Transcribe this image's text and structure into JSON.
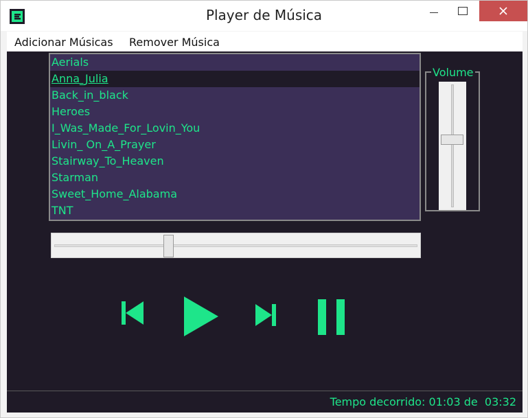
{
  "window": {
    "title": "Player de Música"
  },
  "menu": {
    "items": [
      "Adicionar Músicas",
      "Remover Música"
    ]
  },
  "playlist": {
    "songs": [
      "Aerials",
      "Anna_Julia",
      "Back_in_black",
      "Heroes",
      "I_Was_Made_For_Lovin_You",
      "Livin_ On_A_Prayer",
      "Stairway_To_Heaven",
      "Starman",
      "Sweet_Home_Alabama",
      "TNT"
    ],
    "selected_index": 1
  },
  "volume": {
    "label": "Volume",
    "level": 0.55
  },
  "progress": {
    "position": 0.31
  },
  "controls": {
    "icons": [
      "previous-icon",
      "play-icon",
      "next-icon",
      "pause-icon"
    ]
  },
  "status": {
    "prefix": "Tempo decorrido:",
    "elapsed": "01:03",
    "connector": "de",
    "total": "03:32"
  },
  "colors": {
    "background": "#1f1a27",
    "playlist_bg": "#3b2f57",
    "accent": "#1ee58a"
  }
}
